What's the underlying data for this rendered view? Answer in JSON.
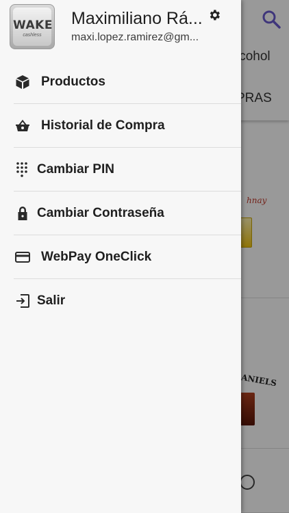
{
  "user": {
    "name": "Maximiliano Rá...",
    "email": "maxi.lopez.ramirez@gm..."
  },
  "logo": {
    "text": "WAKE",
    "tagline": "cashless"
  },
  "menu": {
    "items": [
      {
        "label": "Productos",
        "icon": "box-icon"
      },
      {
        "label": "Historial de Compra",
        "icon": "basket-icon"
      },
      {
        "label": "Cambiar PIN",
        "icon": "dialpad-icon"
      },
      {
        "label": "Cambiar Contraseña",
        "icon": "lock-icon"
      },
      {
        "label": "WebPay OneClick",
        "icon": "credit-card-icon"
      },
      {
        "label": "Salir",
        "icon": "logout-icon"
      }
    ]
  },
  "background": {
    "tab_partial_1": "lcohol",
    "tab_partial_2": "PRAS",
    "brand_partial_1": "hnay",
    "brand_partial_2": "ANIELS"
  },
  "colors": {
    "accent": "#6a5acd",
    "drawer_bg": "#f7f7f7",
    "text": "#1f1f1f"
  }
}
